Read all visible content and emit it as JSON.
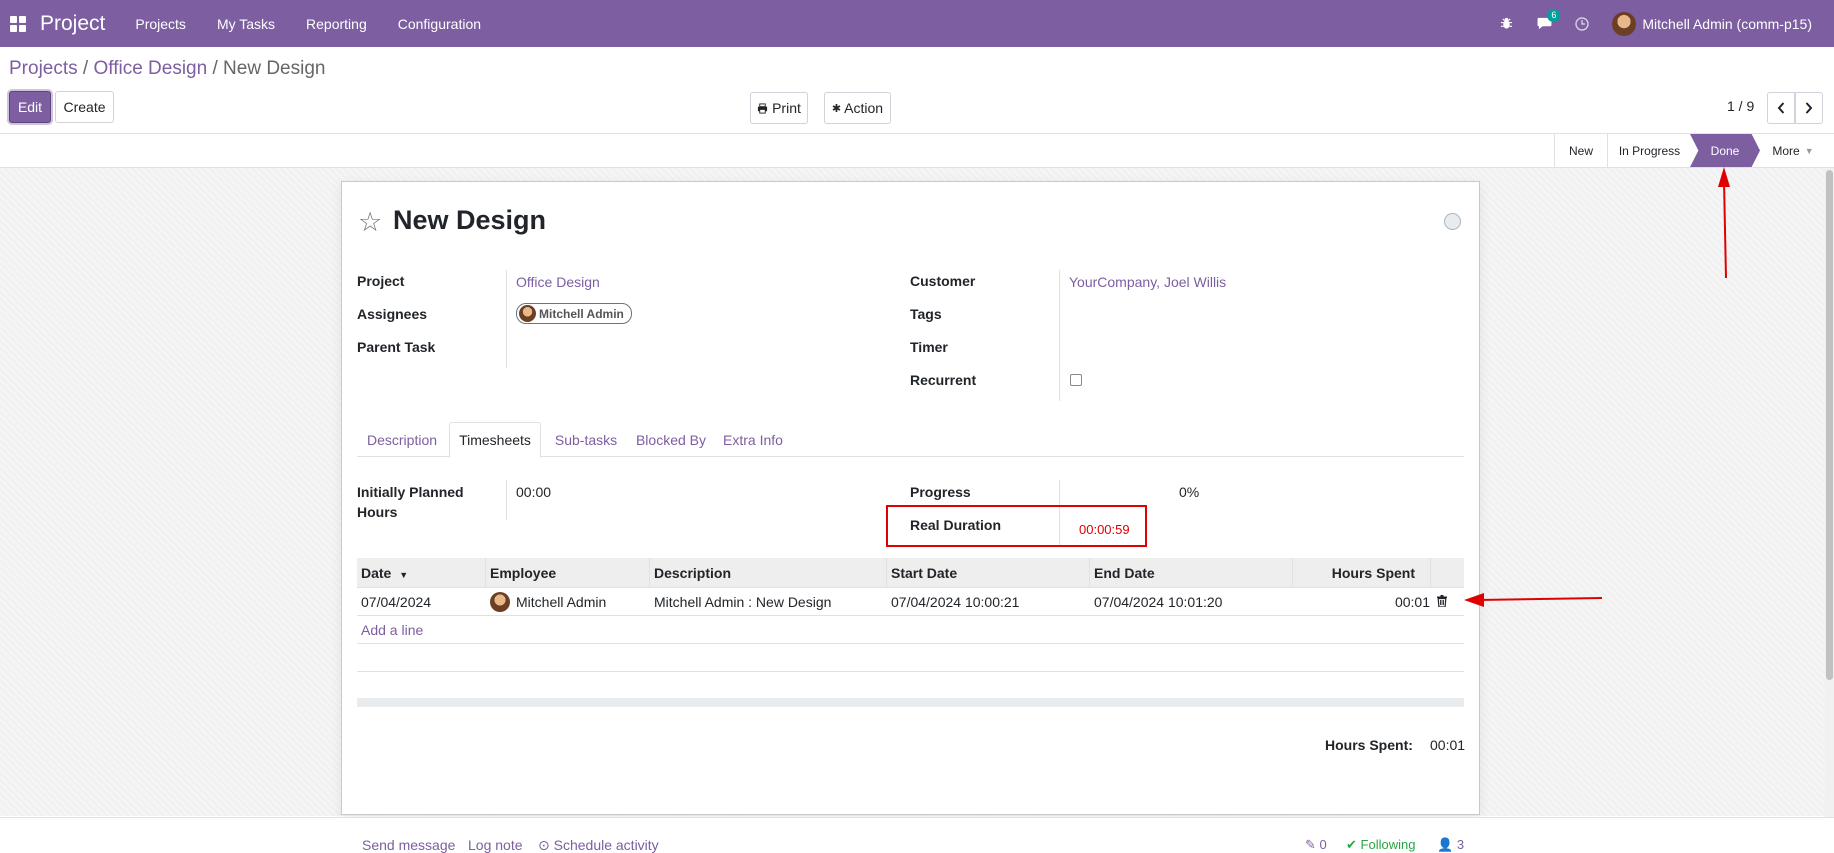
{
  "navbar": {
    "app_title": "Project",
    "menu": [
      "Projects",
      "My Tasks",
      "Reporting",
      "Configuration"
    ],
    "chat_count": "6",
    "user_name": "Mitchell Admin (comm-p15)"
  },
  "breadcrumb": {
    "root": "Projects",
    "parent": "Office Design",
    "current": "New Design",
    "separator": "/"
  },
  "toolbar": {
    "edit_label": "Edit",
    "create_label": "Create",
    "print_label": "Print",
    "action_label": "Action",
    "pager_label": "1 / 9"
  },
  "stages": {
    "items": [
      "New",
      "In Progress",
      "Done"
    ],
    "active": "Done",
    "more_label": "More"
  },
  "task": {
    "title": "New Design",
    "left_fields": [
      {
        "label": "Project",
        "value": "Office Design"
      },
      {
        "label": "Assignees",
        "value": "Mitchell Admin"
      },
      {
        "label": "Parent Task",
        "value": ""
      }
    ],
    "right_fields": [
      {
        "label": "Customer",
        "value": "YourCompany, Joel Willis"
      },
      {
        "label": "Tags",
        "value": ""
      },
      {
        "label": "Timer",
        "value": ""
      },
      {
        "label": "Recurrent",
        "value": ""
      }
    ]
  },
  "tabs": [
    "Description",
    "Timesheets",
    "Sub-tasks",
    "Blocked By",
    "Extra Info"
  ],
  "active_tab": "Timesheets",
  "timesheet_info": {
    "planned_label": "Initially Planned Hours",
    "planned_value": "00:00",
    "progress_label": "Progress",
    "progress_value": "0%",
    "duration_label": "Real Duration",
    "duration_value": "00:00:59"
  },
  "timesheet_table": {
    "columns": [
      "Date",
      "Employee",
      "Description",
      "Start Date",
      "End Date",
      "Hours Spent"
    ],
    "rows": [
      {
        "date": "07/04/2024",
        "employee": "Mitchell Admin",
        "description": "Mitchell Admin : New Design",
        "start": "07/04/2024 10:00:21",
        "end": "07/04/2024 10:01:20",
        "hours": "00:01"
      }
    ],
    "add_line_label": "Add a line"
  },
  "totals": {
    "label": "Hours Spent:",
    "value": "00:01"
  },
  "chatter": {
    "send_message": "Send message",
    "log_note": "Log note",
    "schedule_activity": "Schedule activity",
    "attachments": "0",
    "following_label": "Following",
    "followers": "3"
  },
  "colors": {
    "brand": "#7c5ea1",
    "highlight": "#e00000"
  }
}
